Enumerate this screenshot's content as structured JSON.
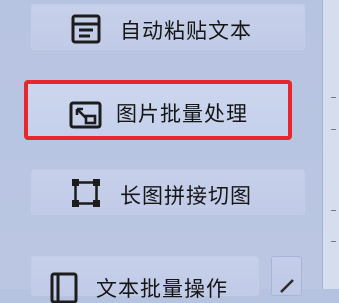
{
  "sidebar": {
    "items": [
      {
        "label": "自动粘贴文本",
        "icon": "paste-text-icon"
      },
      {
        "label": "图片批量处理",
        "icon": "image-batch-icon",
        "selected": true
      },
      {
        "label": "长图拼接切图",
        "icon": "crop-frame-icon"
      },
      {
        "label": "文本批量操作",
        "icon": "book-icon"
      }
    ],
    "highlight_color": "#e8262b"
  }
}
